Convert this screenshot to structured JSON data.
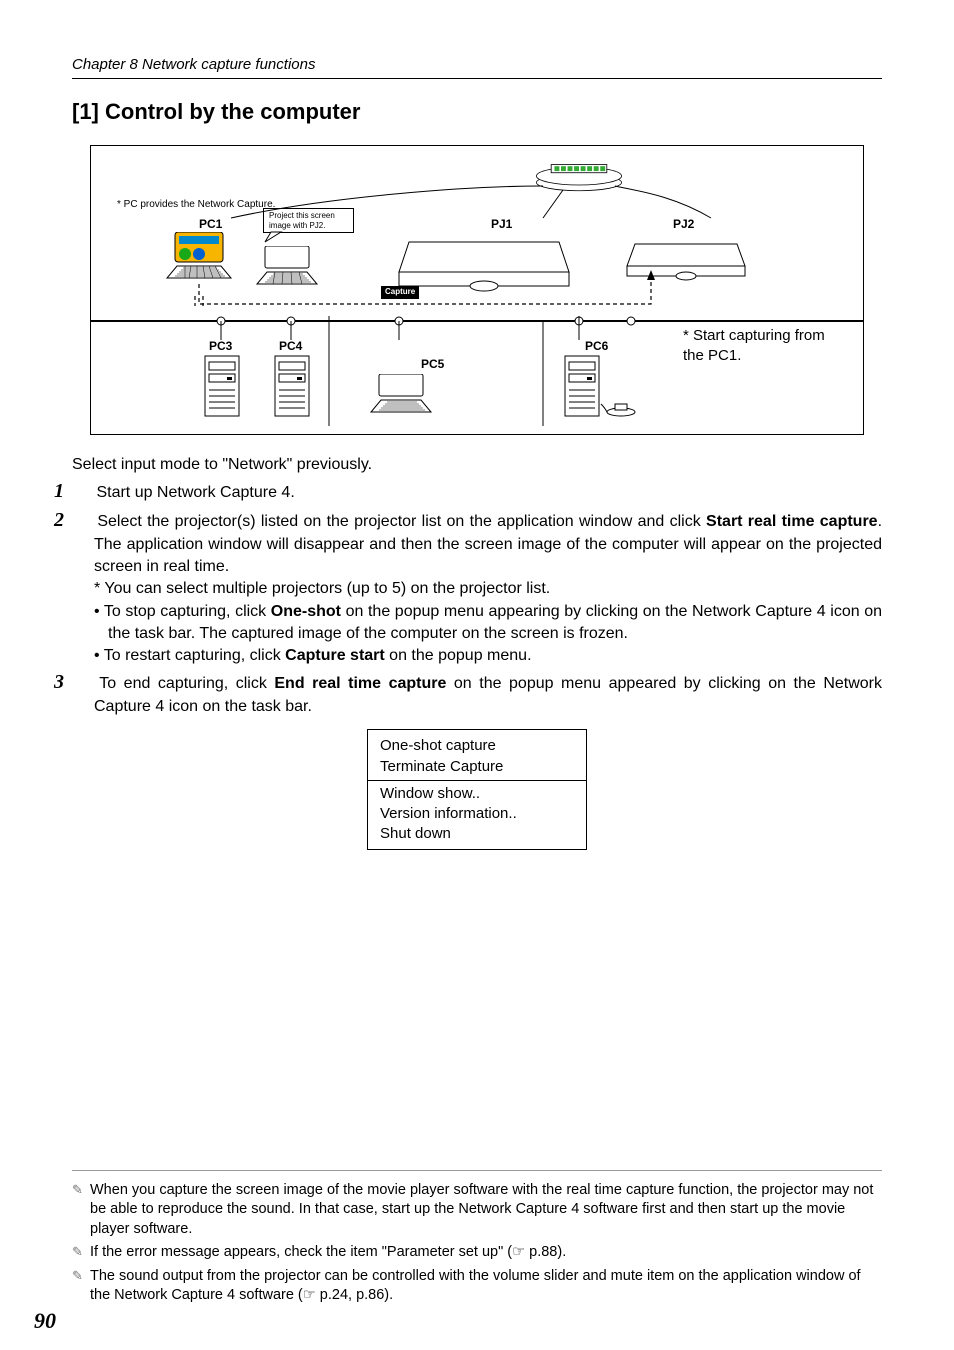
{
  "chapter": "Chapter 8 Network capture functions",
  "heading": "[1] Control by the computer",
  "diagram": {
    "pc_note": "* PC provides the Network Capture.",
    "pc1": "PC1",
    "pc3": "PC3",
    "pc4": "PC4",
    "pc5": "PC5",
    "pc6": "PC6",
    "pj1": "PJ1",
    "pj2": "PJ2",
    "speech_l1": "Project this screen",
    "speech_l2": "image with PJ2.",
    "capture_tag": "Capture",
    "side_note": "* Start capturing from the PC1."
  },
  "intro": "Select input mode to \"Network\" previously.",
  "steps": {
    "s1": "Start up Network Capture 4.",
    "s2_a": "Select the projector(s) listed on the projector list on the application window and click ",
    "s2_bold1": "Start real time capture",
    "s2_b": ". The application window will disappear and then the screen image of the computer will appear on the projected screen in real time.",
    "s2_sub1": "* You can select multiple projectors (up to 5) on the projector list.",
    "s2_sub2_a": "• To stop capturing, click ",
    "s2_sub2_bold": "One-shot",
    "s2_sub2_b": " on the popup menu appearing by clicking on the Network Capture 4 icon on the task bar. The captured image of the computer on the screen is frozen.",
    "s2_sub3_a": "• To restart capturing, click ",
    "s2_sub3_bold": "Capture start",
    "s2_sub3_b": " on the popup menu.",
    "s3_a": "To end capturing, click ",
    "s3_bold": "End real time capture",
    "s3_b": " on the popup menu appeared by clicking on the Network Capture 4 icon on the task bar."
  },
  "menu": {
    "i1": "One-shot capture",
    "i2": "Terminate Capture",
    "i3": "Window show..",
    "i4": "Version information..",
    "i5": "Shut down"
  },
  "footnotes": {
    "f1": "When you capture the screen image of the movie player software with the real time capture function, the projector may not be able to reproduce the sound. In that case, start up the Network Capture 4 software first and then start up the movie player software.",
    "f2_a": "If the error message appears, check the item \"Parameter set up\"  (",
    "f2_b": " p.88).",
    "f3_a": "The sound output from the projector can be controlled with the volume slider and mute item on the application window of the Network Capture 4 software (",
    "f3_b": " p.24, p.86)."
  },
  "page_number": "90"
}
